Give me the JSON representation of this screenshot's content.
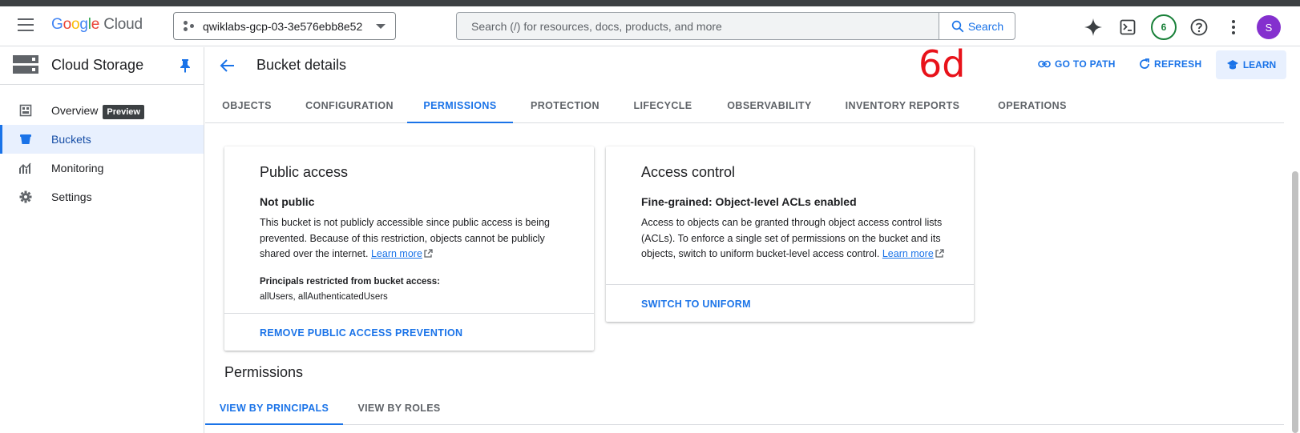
{
  "topbar": {
    "logo_google": "Google",
    "logo_cloud": "Cloud",
    "project": "qwiklabs-gcp-03-3e576ebb8e52",
    "search_placeholder": "Search (/) for resources, docs, products, and more",
    "search_button": "Search",
    "notifications_count": "6",
    "avatar_initial": "S"
  },
  "sidebar": {
    "product_title": "Cloud Storage",
    "items": [
      {
        "label": "Overview",
        "badge": "Preview",
        "icon": "dashboard-icon"
      },
      {
        "label": "Buckets",
        "icon": "bucket-icon",
        "active": true
      },
      {
        "label": "Monitoring",
        "icon": "monitoring-icon"
      },
      {
        "label": "Settings",
        "icon": "gear-icon"
      }
    ]
  },
  "header": {
    "title": "Bucket details",
    "annotation": "6d",
    "go_to_path": "GO TO PATH",
    "refresh": "REFRESH",
    "learn": "LEARN"
  },
  "tabs": [
    "OBJECTS",
    "CONFIGURATION",
    "PERMISSIONS",
    "PROTECTION",
    "LIFECYCLE",
    "OBSERVABILITY",
    "INVENTORY REPORTS",
    "OPERATIONS"
  ],
  "active_tab": "PERMISSIONS",
  "public_access": {
    "title": "Public access",
    "status": "Not public",
    "description": "This bucket is not publicly accessible since public access is being prevented. Because of this restriction, objects cannot be publicly shared over the internet.",
    "learn_more": "Learn more",
    "principals_label": "Principals restricted from bucket access:",
    "principals": "allUsers, allAuthenticatedUsers",
    "action": "REMOVE PUBLIC ACCESS PREVENTION"
  },
  "access_control": {
    "title": "Access control",
    "status": "Fine-grained: Object-level ACLs enabled",
    "description": "Access to objects can be granted through object access control lists (ACLs). To enforce a single set of permissions on the bucket and its objects, switch to uniform bucket-level access control.",
    "learn_more": "Learn more",
    "action": "SWITCH TO UNIFORM"
  },
  "permissions": {
    "title": "Permissions",
    "view_by_principals": "VIEW BY PRINCIPALS",
    "view_by_roles": "VIEW BY ROLES"
  },
  "colors": {
    "accent": "#1a73e8",
    "active_bg": "#e8f0fe",
    "annotation_red": "#e8121a"
  }
}
